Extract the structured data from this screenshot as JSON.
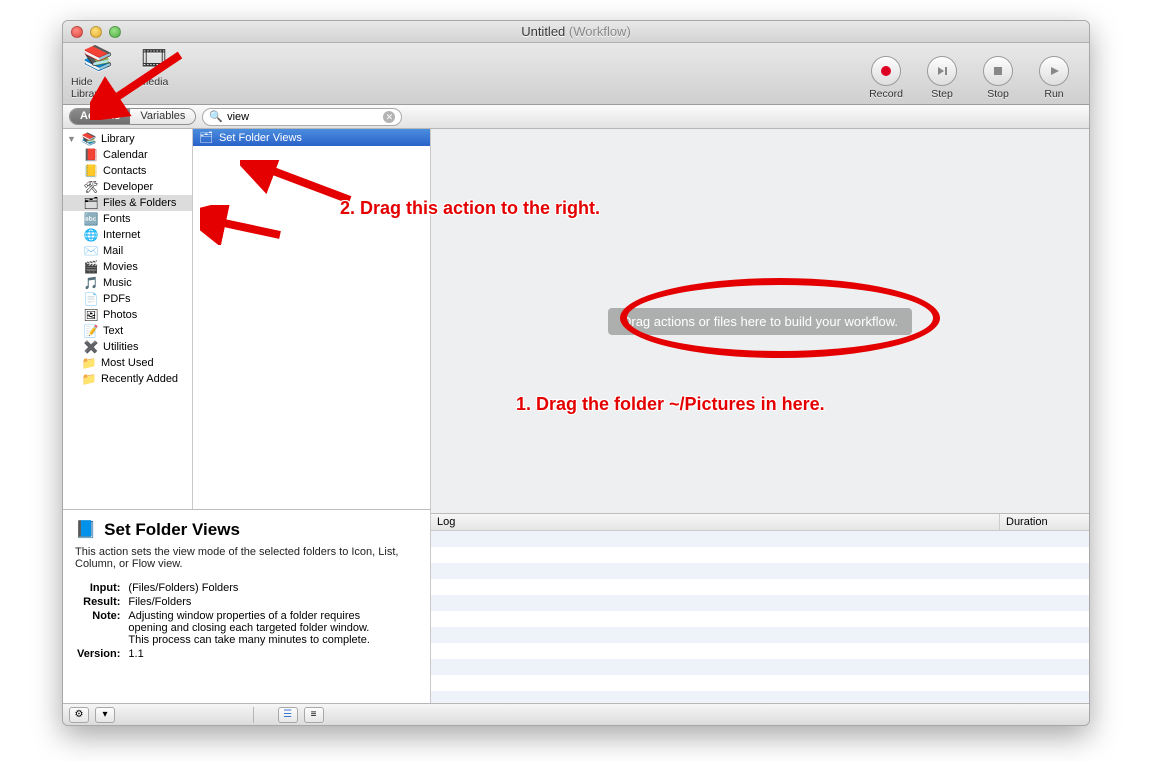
{
  "window": {
    "title": "Untitled",
    "subtitle": "(Workflow)"
  },
  "toolbar": {
    "hide_library": "Hide Library",
    "media": "Media",
    "record": "Record",
    "step": "Step",
    "stop": "Stop",
    "run": "Run"
  },
  "filter": {
    "tabs": {
      "actions": "Actions",
      "variables": "Variables"
    },
    "search_value": "view"
  },
  "library": {
    "root": "Library",
    "items": [
      {
        "icon": "📕",
        "label": "Calendar"
      },
      {
        "icon": "📒",
        "label": "Contacts"
      },
      {
        "icon": "🛠",
        "label": "Developer"
      },
      {
        "icon": "🗂",
        "label": "Files & Folders",
        "selected": true
      },
      {
        "icon": "🔤",
        "label": "Fonts"
      },
      {
        "icon": "🌐",
        "label": "Internet"
      },
      {
        "icon": "✉️",
        "label": "Mail"
      },
      {
        "icon": "🎬",
        "label": "Movies"
      },
      {
        "icon": "🎵",
        "label": "Music"
      },
      {
        "icon": "📄",
        "label": "PDFs"
      },
      {
        "icon": "🖼",
        "label": "Photos"
      },
      {
        "icon": "📝",
        "label": "Text"
      },
      {
        "icon": "✖️",
        "label": "Utilities"
      }
    ],
    "smart": [
      {
        "icon": "📁",
        "label": "Most Used"
      },
      {
        "icon": "📁",
        "label": "Recently Added"
      }
    ]
  },
  "results": [
    {
      "icon": "🗂",
      "label": "Set Folder Views",
      "selected": true
    }
  ],
  "info": {
    "title": "Set Folder Views",
    "description": "This action sets the view mode of the selected folders to Icon, List, Column, or Flow view.",
    "input_label": "Input:",
    "input": "(Files/Folders) Folders",
    "result_label": "Result:",
    "result": "Files/Folders",
    "note_label": "Note:",
    "note": "Adjusting window properties of a folder requires opening and closing each targeted folder window. This process can take many minutes to complete.",
    "version_label": "Version:",
    "version": "1.1"
  },
  "workflow": {
    "placeholder": "Drag actions or files here to build your workflow."
  },
  "log": {
    "col_log": "Log",
    "col_duration": "Duration"
  },
  "annotations": {
    "a1": "1. Drag the folder ~/Pictures in here.",
    "a2": "2. Drag this action to the right."
  }
}
